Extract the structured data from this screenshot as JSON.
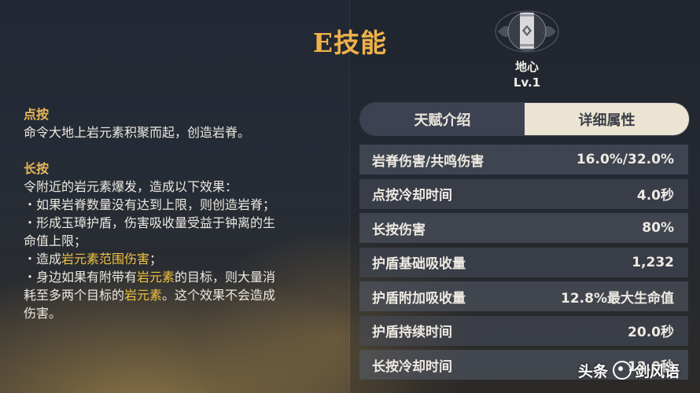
{
  "skill": {
    "title": "E技能",
    "name": "地心",
    "level": "Lv.1"
  },
  "description": {
    "tap_heading": "点按",
    "tap_text": "命令大地上岩元素积聚而起，创造岩脊。",
    "hold_heading": "长按",
    "hold_intro": "令附近的岩元素爆发，造成以下效果：",
    "bullet1": "・如果岩脊数量没有达到上限，则创造岩脊；",
    "bullet2_line1": "・形成玉璋护盾，伤害吸收量受益于钟离的生",
    "bullet2_line2": "命值上限；",
    "bullet3_a": "・造成",
    "bullet3_hl": "岩元素范围伤害",
    "bullet3_b": "；",
    "bullet4_a": "・身边如果有附带有",
    "bullet4_hl": "岩元素",
    "bullet4_b": "的目标，则大量消",
    "bullet4_line2_a": "耗至多两个目标的",
    "bullet4_line2_hl": "岩元素",
    "bullet4_line2_b": "。这个效果不会造成",
    "bullet4_line3": "伤害。"
  },
  "tabs": {
    "intro": "天赋介绍",
    "detail": "详细属性",
    "active": "detail"
  },
  "attributes": [
    {
      "label": "岩脊伤害/共鸣伤害",
      "value": "16.0%/32.0%"
    },
    {
      "label": "点按冷却时间",
      "value": "4.0秒"
    },
    {
      "label": "长按伤害",
      "value": "80%"
    },
    {
      "label": "护盾基础吸收量",
      "value": "1,232"
    },
    {
      "label": "护盾附加吸收量",
      "value": "12.8%最大生命值"
    },
    {
      "label": "护盾持续时间",
      "value": "20.0秒"
    },
    {
      "label": "长按冷却时间",
      "value": "12.0秒"
    }
  ],
  "watermark": {
    "prefix": "头条",
    "at": "@",
    "name": "剑风语"
  },
  "colors": {
    "title": "#f0b14a",
    "heading": "#e8b85a",
    "highlight": "#f0c040"
  }
}
